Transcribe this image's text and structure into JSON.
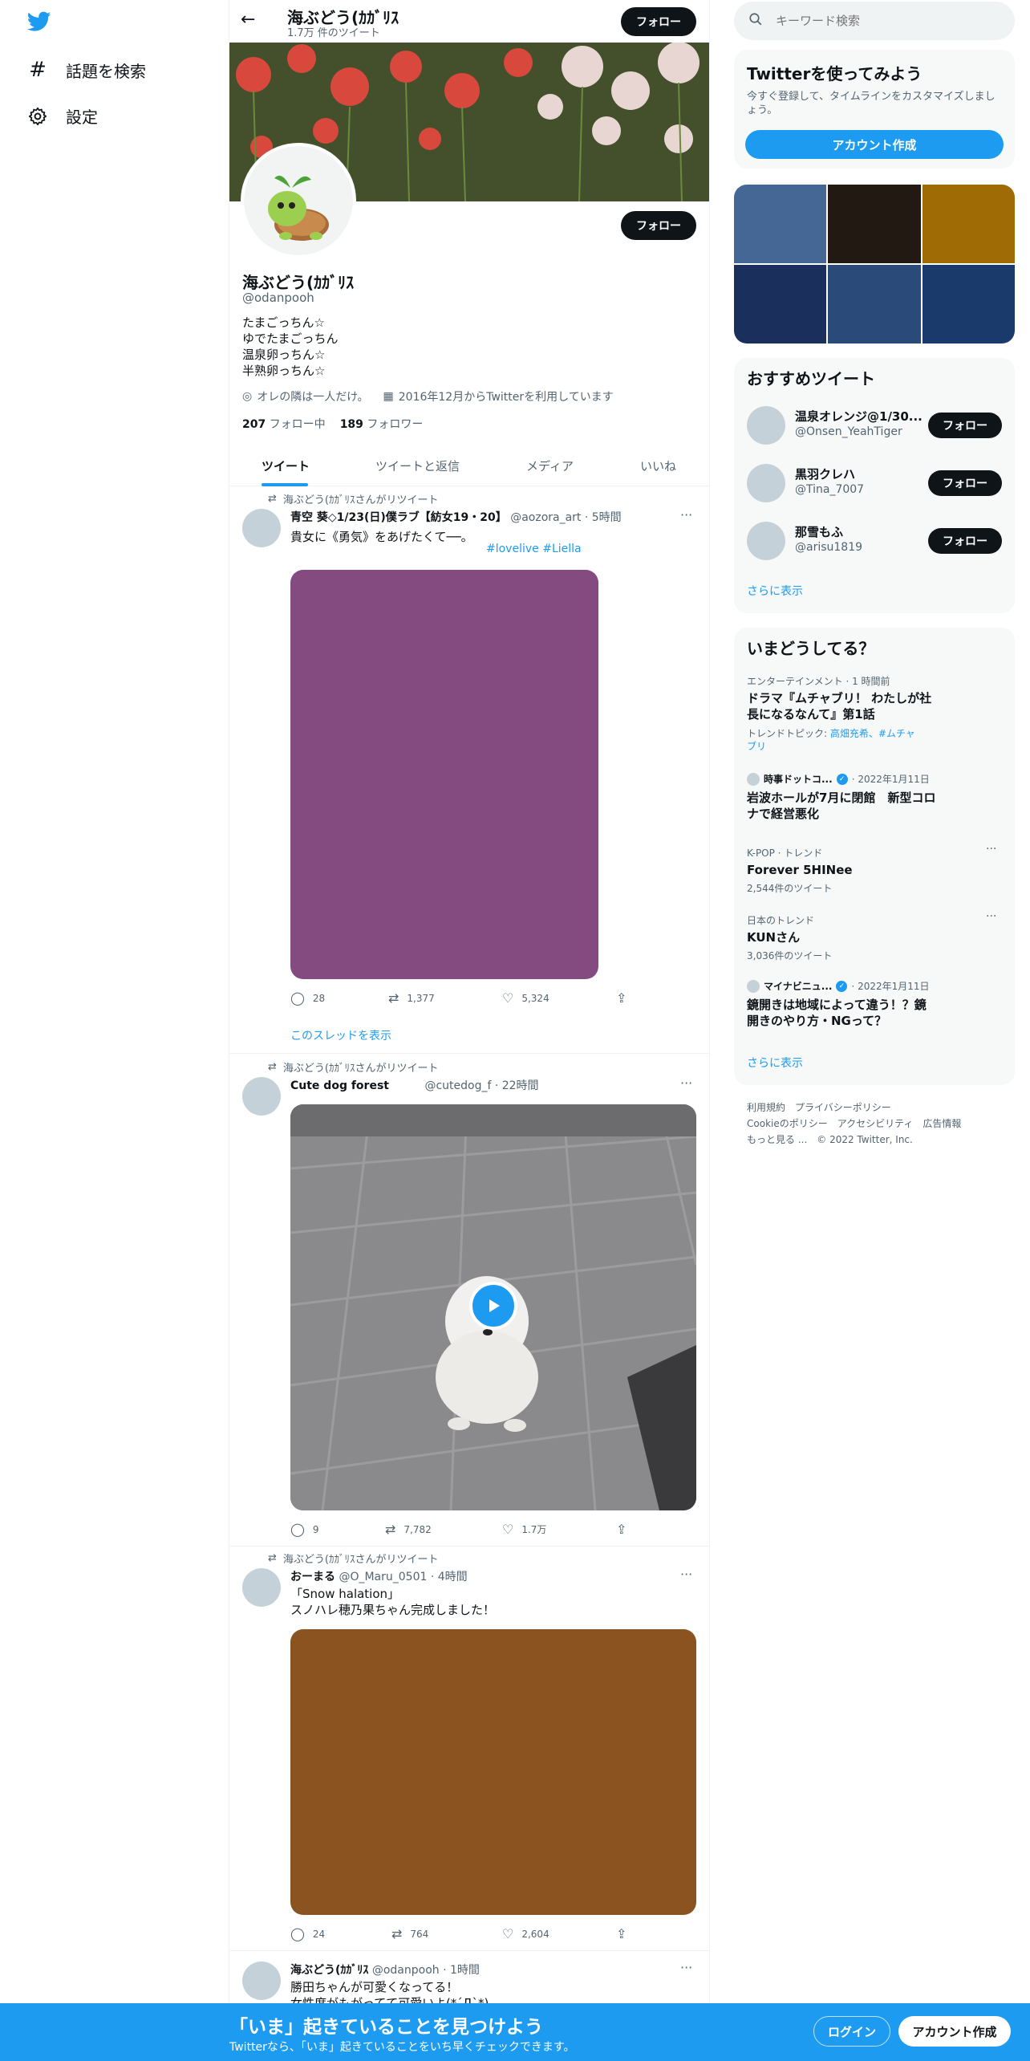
{
  "nav": {
    "explore_label": "話題を検索",
    "settings_label": "設定"
  },
  "header": {
    "name": "海ぶどう(ｶｶﾞﾘｽ",
    "tweet_count": "1.7万 件のツイート",
    "follow_label": "フォロー"
  },
  "profile": {
    "follow_label": "フォロー",
    "name": "海ぶどう(ｶｶﾞﾘｽ",
    "handle": "@odanpooh",
    "bio": [
      "たまごっちん☆",
      "ゆでたまごっちん",
      "温泉卵っちん☆",
      "半熟卵っちん☆"
    ],
    "location": "オレの隣は一人だけ。",
    "joined": "2016年12月からTwitterを利用しています",
    "following_count": "207",
    "following_label": "フォロー中",
    "followers_count": "189",
    "followers_label": "フォロワー"
  },
  "tabs": [
    "ツイート",
    "ツイートと返信",
    "メディア",
    "いいね"
  ],
  "tweets": [
    {
      "retweeted_by": "海ぶどう(ｶｶﾞﾘｽさんがリツイート",
      "author": "青空 葵◇1/23(日)僕ラブ【紡女19・20】",
      "handle_time": "@aozora_art · 5時間",
      "text": "貴女に《勇気》をあげたくて──。",
      "hashtags": "#lovelive #Liella",
      "media_color": "#844b80",
      "replies": "28",
      "retweets": "1,377",
      "likes": "5,324",
      "thread_link": "このスレッドを表示"
    },
    {
      "retweeted_by": "海ぶどう(ｶｶﾞﾘｽさんがリツイート",
      "author": "Cute dog forest",
      "handle_time": "@cutedog_f · 22時間",
      "replies": "9",
      "retweets": "7,782",
      "likes": "1.7万"
    },
    {
      "retweeted_by": "海ぶどう(ｶｶﾞﾘｽさんがリツイート",
      "author": "おーまる",
      "handle_time": "@O_Maru_0501 · 4時間",
      "text_line1": "「Snow halation」",
      "text_line2": "スノハレ穂乃果ちゃん完成しました！",
      "media_color": "#8b531f",
      "replies": "24",
      "retweets": "764",
      "likes": "2,604"
    },
    {
      "author": "海ぶどう(ｶｶﾞﾘｽ",
      "handle_time": "@odanpooh · 1時間",
      "text_line1": "勝田ちゃんが可愛くなってる！",
      "text_line2": "女性度がもがってて可愛いよ(*´Д`*)"
    }
  ],
  "search": {
    "placeholder": "キーワード検索"
  },
  "signup": {
    "title": "Twitterを使ってみよう",
    "description": "今すぐ登録して、タイムラインをカスタマイズしましょう。",
    "button": "アカウント作成"
  },
  "media_grid_colors": [
    "#456795",
    "#221912",
    "#9e6b05",
    "#1a2f5c",
    "#2a4a7a",
    "#1a3a6b"
  ],
  "recommend": {
    "title": "おすすめツイート",
    "users": [
      {
        "name": "温泉オレンジ@1/30...",
        "handle": "@Onsen_YeahTiger",
        "follow": "フォロー"
      },
      {
        "name": "黒羽クレハ",
        "handle": "@Tina_7007",
        "follow": "フォロー"
      },
      {
        "name": "那雪もふ",
        "handle": "@arisu1819",
        "follow": "フォロー"
      }
    ],
    "more": "さらに表示"
  },
  "trends": {
    "title": "いまどうしてる？",
    "items": [
      {
        "meta": "エンターテインメント · 1 時間前",
        "title_line1": "ドラマ『ムチャブリ！ わたしが社",
        "title_line2": "長になるなんて』第1話",
        "topic_prefix": "トレンドトピック:",
        "topic_link1": "高畑充希、#ムチャ",
        "topic_link2": "ブリ"
      },
      {
        "source": "時事ドットコ...",
        "date": "· 2022年1月11日",
        "title_line1": "岩波ホールが7月に閉館　新型コロ",
        "title_line2": "ナで経営悪化"
      },
      {
        "meta": "K-POP · トレンド",
        "title": "Forever 5HINee",
        "count": "2,544件のツイート"
      },
      {
        "meta": "日本のトレンド",
        "title": "KUNさん",
        "count": "3,036件のツイート"
      },
      {
        "source": "マイナビニュ...",
        "date": "· 2022年1月11日",
        "title_line1": "鏡開きは地域によって違う！？鏡",
        "title_line2": "開きのやり方・NGって？"
      }
    ],
    "more": "さらに表示"
  },
  "footer_links": {
    "line1": "利用規約　プライバシーポリシー",
    "line2": "Cookieのポリシー　アクセシビリティ　広告情報",
    "line3": "もっと見る ...　© 2022 Twitter, Inc."
  },
  "bottom_bar": {
    "title": "「いま」起きていることを見つけよう",
    "subtitle": "Twitterなら、「いま」起きていることをいち早くチェックできます。",
    "login": "ログイン",
    "signup": "アカウント作成",
    "color": "#1d9bf0"
  }
}
